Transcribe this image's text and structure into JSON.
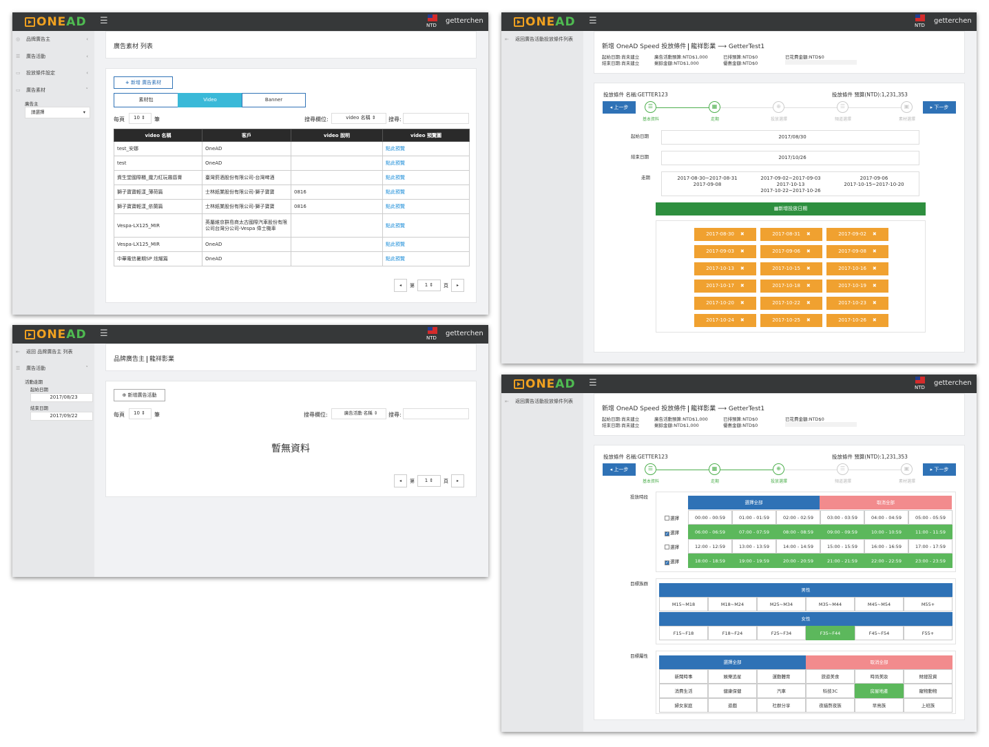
{
  "app": {
    "logo_one": "ONE",
    "logo_ad": "AD",
    "currency": "NTD",
    "username": "getterchen",
    "menu_icon": "☰"
  },
  "win1": {
    "sidebar": [
      "品牌廣告主",
      "廣告活動",
      "投放條件設定",
      "廣告素材"
    ],
    "advertiser_label": "廣告主",
    "advertiser_select": "請選擇",
    "page_title": "廣告素材 列表",
    "add_button": "新增 廣告素材",
    "tabs": [
      "素材包",
      "Video",
      "Banner"
    ],
    "per_page_label": "每頁",
    "per_page_value": "10",
    "per_page_unit": "筆",
    "search_field_label": "搜尋欄位:",
    "search_field_value": "video 名稱",
    "search_label": "搜尋:",
    "columns": [
      "video 名稱",
      "客戶",
      "video 說明",
      "video 預覽圖"
    ],
    "rows": [
      [
        "test_安娜",
        "OneAD",
        "",
        "點此預覽"
      ],
      [
        "test",
        "OneAD",
        "",
        "點此預覽"
      ],
      [
        "資生堂國際櫃_魔力紅玩霧唇膏",
        "臺灣菸酒股份有限公司-台灣啤酒",
        "",
        "點此預覽"
      ],
      [
        "獅子寶寶輕漾_薄荷篇",
        "士林紙業股份有限公司-獅子寶寶",
        "0816",
        "點此預覽"
      ],
      [
        "獅子寶寶輕漾_依蘭篇",
        "士林紙業股份有限公司-獅子寶寶",
        "0816",
        "點此預覽"
      ],
      [
        "Vespa-LX125_MIR",
        "英屬維京群島商太古國際汽車股份有限公司台灣分公司-Vespa 偉士機車",
        "",
        "點此預覽"
      ],
      [
        "Vespa-LX125_MIR",
        "OneAD",
        "",
        "點此預覽"
      ],
      [
        "中華電信暑期SP 炫耀篇",
        "OneAD",
        "",
        "點此預覽"
      ]
    ],
    "page_prefix": "第",
    "page_value": "1",
    "page_suffix": "頁"
  },
  "win2": {
    "back_link": "返回 品牌廣告主 列表",
    "campaign_menu": "廣告活動",
    "period_label": "活動走期",
    "start_label": "起始日期",
    "start_value": "2017/08/23",
    "end_label": "結束日期",
    "end_value": "2017/09/22",
    "title_a": "品牌廣告主",
    "title_b": "龍祥影業",
    "add_button": "新增廣告活動",
    "per_page_label": "每頁",
    "per_page_value": "10",
    "per_page_unit": "筆",
    "search_field_label": "搜尋欄位:",
    "search_field_value": "廣告活動 名稱",
    "search_label": "搜尋:",
    "empty_text": "暫無資料",
    "page_prefix": "第",
    "page_value": "1",
    "page_suffix": "頁"
  },
  "win3": {
    "back_link": "返回廣告活動投放條件列表",
    "title_a": "新增 OneAD Speed 投放條件",
    "title_b": "龍祥影業",
    "title_c": "GetterTest1",
    "info": [
      "起始日期:尚未建立",
      "結束日期:尚未建立",
      "廣告活動預算:NTD$1,000",
      "剩餘金額:NTD$1,000",
      "已排預算:NTD$0",
      "優惠金額:NTD$0",
      "已花費金額:NTD$0"
    ],
    "cond_name": "投放條件 名稱:GETTER123",
    "cond_budget": "投放條件 預算(NTD):1,231,353",
    "prev": "上一步",
    "next": "下一步",
    "steps": [
      "基本資料",
      "走期",
      "投放選擇",
      "頻道選擇",
      "素材選擇"
    ],
    "start_label": "起始日期",
    "start_value": "2017/08/30",
    "end_label": "結束日期",
    "end_value": "2017/10/26",
    "period_label": "走期",
    "periods": [
      [
        "2017-08-30~2017-08-31",
        "2017-09-08"
      ],
      [
        "2017-09-02~2017-09-03",
        "2017-10-13",
        "2017-10-22~2017-10-26"
      ],
      [
        "2017-09-06",
        "2017-10-15~2017-10-20"
      ]
    ],
    "add_date_button": "新增投放日期",
    "dates": [
      "2017-08-30",
      "2017-08-31",
      "2017-09-02",
      "2017-09-03",
      "2017-09-06",
      "2017-09-08",
      "2017-10-13",
      "2017-10-15",
      "2017-10-16",
      "2017-10-17",
      "2017-10-18",
      "2017-10-19",
      "2017-10-20",
      "2017-10-22",
      "2017-10-23",
      "2017-10-24",
      "2017-10-25",
      "2017-10-26"
    ]
  },
  "win4": {
    "back_link": "返回廣告活動投放條件列表",
    "title_a": "新增 OneAD Speed 投放條件",
    "title_b": "龍祥影業",
    "title_c": "GetterTest1",
    "info": [
      "起始日期:尚未建立",
      "結束日期:尚未建立",
      "廣告活動預算:NTD$1,000",
      "剩餘金額:NTD$1,000",
      "已排預算:NTD$0",
      "優惠金額:NTD$0",
      "已花費金額:NTD$0"
    ],
    "cond_name": "投放條件 名稱:GETTER123",
    "cond_budget": "投放條件 預算(NTD):1,231,353",
    "prev": "上一步",
    "next": "下一步",
    "steps": [
      "基本資料",
      "走期",
      "投放選擇",
      "頻道選擇",
      "素材選擇"
    ],
    "time_label": "投放時段",
    "select_all": "選擇全部",
    "cancel_all": "取消全部",
    "select_row": "選擇",
    "time_rows": [
      {
        "checked": false,
        "slots": [
          "00:00 - 00:59",
          "01:00 - 01:59",
          "02:00 - 02:59",
          "03:00 - 03:59",
          "04:00 - 04:59",
          "05:00 - 05:59"
        ]
      },
      {
        "checked": true,
        "slots": [
          "06:00 - 06:59",
          "07:00 - 07:59",
          "08:00 - 08:59",
          "09:00 - 09:59",
          "10:00 - 10:59",
          "11:00 - 11:59"
        ]
      },
      {
        "checked": false,
        "slots": [
          "12:00 - 12:59",
          "13:00 - 13:59",
          "14:00 - 14:59",
          "15:00 - 15:59",
          "16:00 - 16:59",
          "17:00 - 17:59"
        ]
      },
      {
        "checked": true,
        "slots": [
          "18:00 - 18:59",
          "19:00 - 19:59",
          "20:00 - 20:59",
          "21:00 - 21:59",
          "22:00 - 22:59",
          "23:00 - 23:59"
        ]
      }
    ],
    "audience_label": "目標族群",
    "male": "男性",
    "male_groups": [
      "M15~M18",
      "M18~M24",
      "M25~M34",
      "M35~M44",
      "M45~M54",
      "M55+"
    ],
    "female": "女性",
    "female_groups": [
      "F15~F18",
      "F18~F24",
      "F25~F34",
      "F35~F44",
      "F45~F54",
      "F55+"
    ],
    "female_selected": 3,
    "attr_label": "目標屬性",
    "attrs": [
      [
        "新聞時事",
        "娛樂追星",
        "運動體育",
        "旅遊美食",
        "時尚美妝",
        "財經投資"
      ],
      [
        "消費生活",
        "健康保健",
        "汽車",
        "科技3C",
        "房屋地產",
        "寵物動物"
      ],
      [
        "婦女家庭",
        "遊戲",
        "社群分享",
        "夜貓熬夜族",
        "早鳥族",
        "上班族"
      ]
    ],
    "attr_selected": [
      1,
      4
    ]
  },
  "colors": {
    "accent_blue": "#2f72b6",
    "green": "#5cb85c",
    "orange": "#f0a130",
    "pink": "#f28b8d",
    "cyan_tab": "#3ab9d8"
  }
}
